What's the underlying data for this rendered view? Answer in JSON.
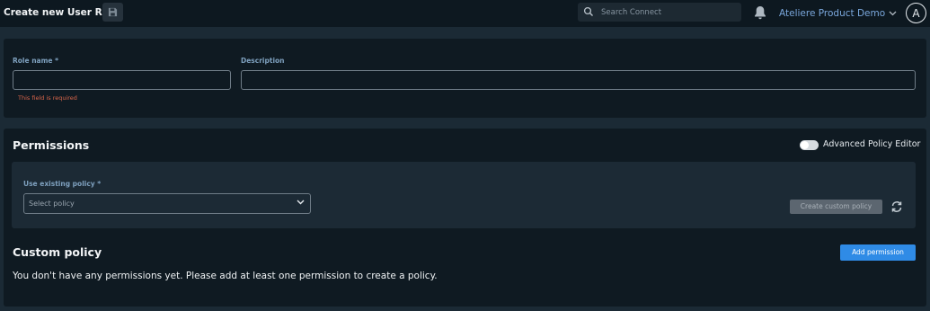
{
  "header": {
    "title": "Create new User Role",
    "save_icon": "floppy-disk-icon",
    "search": {
      "placeholder": "Search Connect",
      "value": ""
    },
    "notifications_icon": "bell-icon",
    "org_name": "Ateliere Product Demo",
    "avatar_initial": "A"
  },
  "role_form": {
    "role_name_label": "Role name *",
    "role_name_value": "",
    "role_name_error": "This field is required",
    "description_label": "Description",
    "description_value": ""
  },
  "permissions": {
    "title": "Permissions",
    "advanced_editor_label": "Advanced Policy Editor",
    "advanced_editor_on": false,
    "use_existing_label": "Use existing policy *",
    "select_value": "Select policy",
    "create_custom_label": "Create custom policy",
    "refresh_icon": "refresh-icon"
  },
  "custom_policy": {
    "title": "Custom policy",
    "add_permission_label": "Add permission",
    "empty_message": "You don't have any permissions yet. Please add at least one permission to create a policy."
  },
  "colors": {
    "background": "#1b2a35",
    "topbar": "#0d1820",
    "card": "#0f1a22",
    "accent": "#2f8be6",
    "error": "#d9654a",
    "label": "#7ea0be"
  }
}
